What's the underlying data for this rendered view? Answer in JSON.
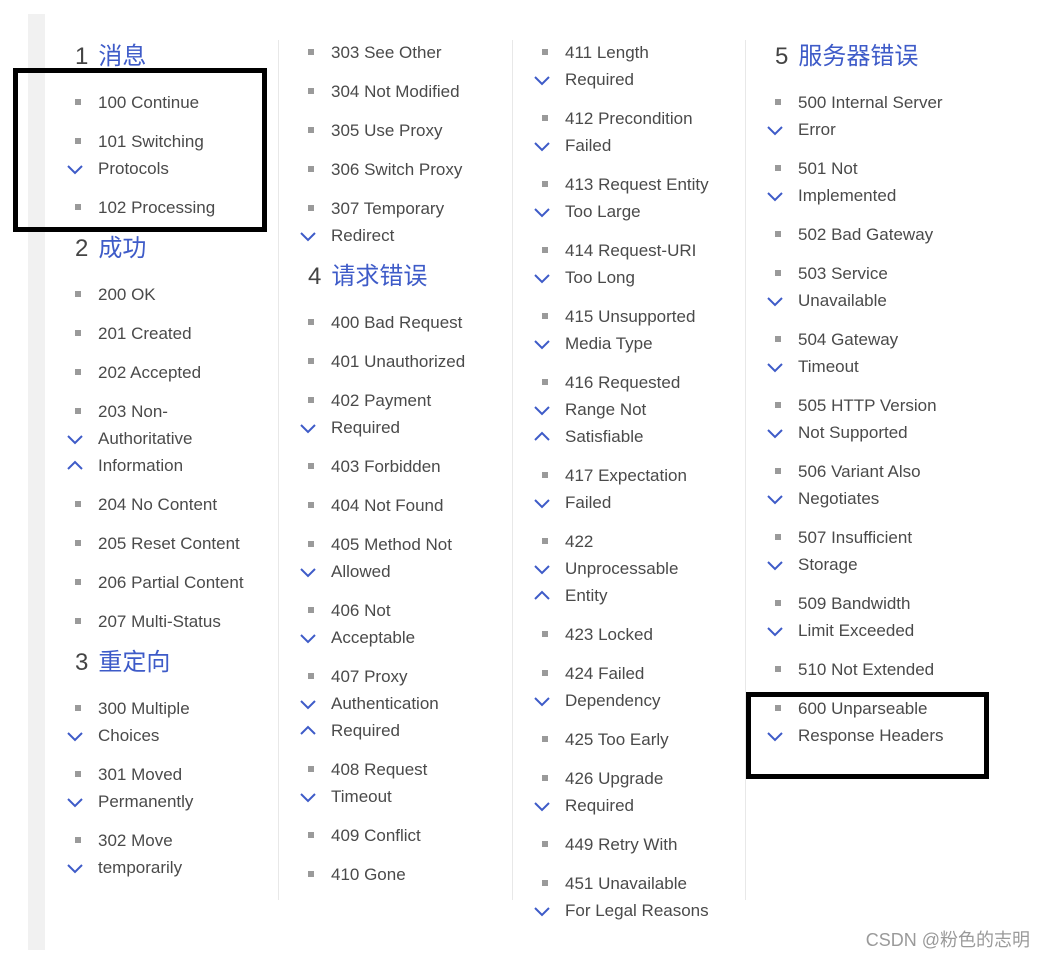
{
  "columns": [
    {
      "blocks": [
        {
          "heading": {
            "num": "1",
            "name": "消息"
          }
        },
        {
          "lines": [
            "100 Continue"
          ]
        },
        {
          "lines": [
            "101 Switching",
            "Protocols"
          ]
        },
        {
          "lines": [
            "102 Processing"
          ]
        },
        {
          "heading": {
            "num": "2",
            "name": "成功"
          }
        },
        {
          "lines": [
            "200 OK"
          ]
        },
        {
          "lines": [
            "201 Created"
          ]
        },
        {
          "lines": [
            "202 Accepted"
          ]
        },
        {
          "lines": [
            "203 Non-",
            "Authoritative",
            "Information"
          ]
        },
        {
          "lines": [
            "204 No Content"
          ]
        },
        {
          "lines": [
            "205 Reset Content"
          ]
        },
        {
          "lines": [
            "206 Partial Content"
          ]
        },
        {
          "lines": [
            "207 Multi-Status"
          ]
        },
        {
          "heading": {
            "num": "3",
            "name": "重定向"
          }
        },
        {
          "lines": [
            "300 Multiple",
            "Choices"
          ]
        },
        {
          "lines": [
            "301 Moved",
            "Permanently"
          ]
        },
        {
          "lines": [
            "302 Move",
            "temporarily"
          ]
        }
      ]
    },
    {
      "blocks": [
        {
          "lines": [
            "303 See Other"
          ]
        },
        {
          "lines": [
            "304 Not Modified"
          ]
        },
        {
          "lines": [
            "305 Use Proxy"
          ]
        },
        {
          "lines": [
            "306 Switch Proxy"
          ]
        },
        {
          "lines": [
            "307 Temporary",
            "Redirect"
          ]
        },
        {
          "heading": {
            "num": "4",
            "name": "请求错误"
          }
        },
        {
          "lines": [
            "400 Bad Request"
          ]
        },
        {
          "lines": [
            "401 Unauthorized"
          ]
        },
        {
          "lines": [
            "402 Payment",
            "Required"
          ]
        },
        {
          "lines": [
            "403 Forbidden"
          ]
        },
        {
          "lines": [
            "404 Not Found"
          ]
        },
        {
          "lines": [
            "405 Method Not",
            "Allowed"
          ]
        },
        {
          "lines": [
            "406 Not",
            "Acceptable"
          ]
        },
        {
          "lines": [
            "407 Proxy",
            "Authentication",
            "Required"
          ]
        },
        {
          "lines": [
            "408 Request",
            "Timeout"
          ]
        },
        {
          "lines": [
            "409 Conflict"
          ]
        },
        {
          "lines": [
            "410 Gone"
          ]
        }
      ]
    },
    {
      "blocks": [
        {
          "lines": [
            "411 Length",
            "Required"
          ]
        },
        {
          "lines": [
            "412 Precondition",
            "Failed"
          ]
        },
        {
          "lines": [
            "413 Request Entity",
            "Too Large"
          ]
        },
        {
          "lines": [
            "414 Request-URI",
            "Too Long"
          ]
        },
        {
          "lines": [
            "415 Unsupported",
            "Media Type"
          ]
        },
        {
          "lines": [
            "416 Requested",
            "Range Not",
            "Satisfiable"
          ]
        },
        {
          "lines": [
            "417 Expectation",
            "Failed"
          ]
        },
        {
          "lines": [
            "422",
            "Unprocessable",
            "Entity"
          ]
        },
        {
          "lines": [
            "423 Locked"
          ]
        },
        {
          "lines": [
            "424 Failed",
            "Dependency"
          ]
        },
        {
          "lines": [
            "425 Too Early"
          ]
        },
        {
          "lines": [
            "426 Upgrade",
            "Required"
          ]
        },
        {
          "lines": [
            "449 Retry With"
          ]
        },
        {
          "lines": [
            "451 Unavailable",
            "For Legal Reasons"
          ]
        }
      ]
    },
    {
      "blocks": [
        {
          "heading": {
            "num": "5",
            "name": "服务器错误"
          }
        },
        {
          "lines": [
            "500 Internal Server",
            "Error"
          ]
        },
        {
          "lines": [
            "501 Not",
            "Implemented"
          ]
        },
        {
          "lines": [
            "502 Bad Gateway"
          ]
        },
        {
          "lines": [
            "503 Service",
            "Unavailable"
          ]
        },
        {
          "lines": [
            "504 Gateway",
            "Timeout"
          ]
        },
        {
          "lines": [
            "505 HTTP Version",
            "Not Supported"
          ]
        },
        {
          "lines": [
            "506 Variant Also",
            "Negotiates"
          ]
        },
        {
          "lines": [
            "507 Insufficient",
            "Storage"
          ]
        },
        {
          "lines": [
            "509 Bandwidth",
            "Limit Exceeded"
          ]
        },
        {
          "lines": [
            "510 Not Extended"
          ]
        },
        {
          "lines": [
            "600 Unparseable",
            "Response Headers"
          ]
        }
      ]
    }
  ],
  "colors": {
    "heading": "#3e5bc8",
    "chevron": "#3e5bc8",
    "highlight_box": "#000000"
  },
  "watermark": "CSDN @粉色的志明"
}
